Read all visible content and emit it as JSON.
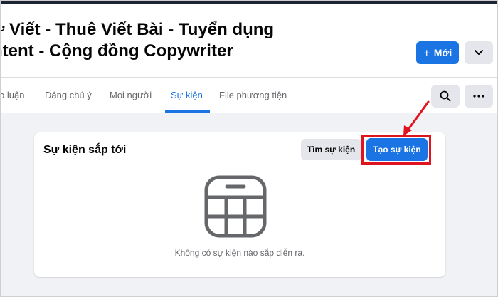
{
  "header": {
    "title_line1": "ự Viết - Thuê Viết Bài - Tuyển dụng",
    "title_line2": "ntent - Cộng đồng Copywriter",
    "new_button_label": "Mới",
    "new_button_icon": "+",
    "more_icon": "chevron-down-icon"
  },
  "tabs": {
    "items": [
      {
        "label": "o luận"
      },
      {
        "label": "Đáng chú ý"
      },
      {
        "label": "Mọi người"
      },
      {
        "label": "Sự kiện"
      },
      {
        "label": "File phương tiện"
      }
    ],
    "active": "Sự kiện",
    "search_icon": "search-icon",
    "more_icon": "ellipsis-icon"
  },
  "events": {
    "heading": "Sự kiện sắp tới",
    "find_label": "Tìm sự kiện",
    "create_label": "Tạo sự kiện",
    "empty_message": "Không có sự kiện nào sắp diễn ra.",
    "empty_icon": "calendar-icon"
  },
  "colors": {
    "accent": "#1b74e4",
    "highlight": "#e0141e",
    "background": "#f0f2f5"
  }
}
